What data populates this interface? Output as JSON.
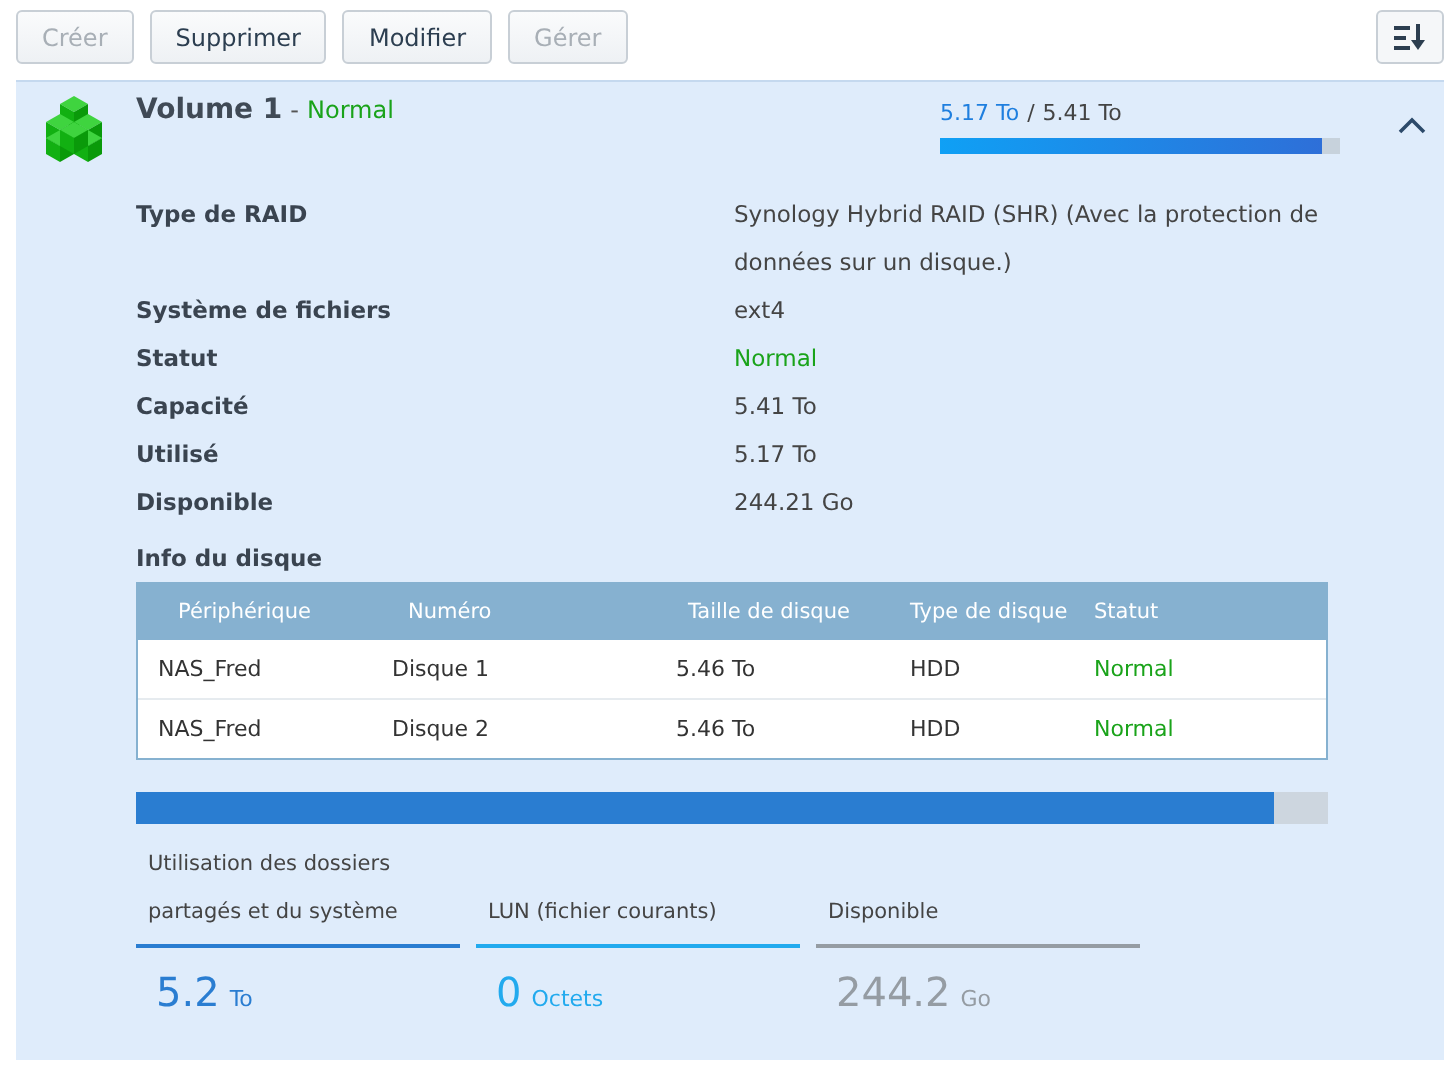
{
  "toolbar": {
    "buttons": [
      {
        "label": "Créer",
        "disabled": true
      },
      {
        "label": "Supprimer",
        "disabled": false
      },
      {
        "label": "Modifier",
        "disabled": false
      },
      {
        "label": "Gérer",
        "disabled": true
      }
    ]
  },
  "volume": {
    "title": "Volume 1",
    "separator": "-",
    "status": "Normal",
    "used": "5.17 To",
    "slash": "/",
    "total": "5.41 To",
    "level": 0.955,
    "expanded": true,
    "details": [
      {
        "label": "Type de RAID",
        "value": "Synology Hybrid RAID (SHR) (Avec la protection de données sur un disque.)",
        "kind": "plain"
      },
      {
        "label": "Système de fichiers",
        "value": "ext4",
        "kind": "plain"
      },
      {
        "label": "Statut",
        "value": "Normal",
        "kind": "status"
      },
      {
        "label": "Capacité",
        "value": "5.41 To",
        "kind": "plain"
      },
      {
        "label": "Utilisé",
        "value": "5.17 To",
        "kind": "plain"
      },
      {
        "label": "Disponible",
        "value": "244.21 Go",
        "kind": "plain"
      }
    ],
    "disk_info": {
      "title": "Info du disque",
      "columns": [
        "Périphérique",
        "Numéro",
        "Taille de disque",
        "Type de disque",
        "Statut"
      ],
      "rows": [
        [
          "NAS_Fred",
          "Disque 1",
          "5.46 To",
          "HDD",
          "Normal"
        ],
        [
          "NAS_Fred",
          "Disque 2",
          "5.46 To",
          "HDD",
          "Normal"
        ]
      ]
    },
    "storage": {
      "level": 0.955,
      "legend": [
        {
          "label": "Utilisation des dossiers partagés et du système",
          "value": "5.2",
          "unit": "To",
          "color": "#2a7dd1"
        },
        {
          "label": "LUN (fichier courants)",
          "value": "0",
          "unit": "Octets",
          "color": "#22aaee"
        },
        {
          "label": "Disponible",
          "value": "244.2",
          "unit": "Go",
          "color": "#959ca3"
        }
      ]
    }
  }
}
